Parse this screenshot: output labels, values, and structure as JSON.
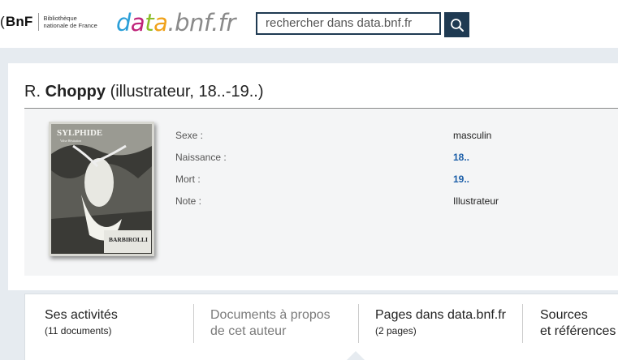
{
  "header": {
    "bnf_logo": {
      "mark": "BnF",
      "line1": "Bibliothèque",
      "line2": "nationale de France"
    },
    "site_logo": {
      "p1": "d",
      "p2": "a",
      "p3": "t",
      "p4": "a",
      "rest": ".bnf.fr"
    },
    "search": {
      "placeholder": "rechercher dans data.bnf.fr"
    }
  },
  "person": {
    "first": "R.",
    "last": "Choppy",
    "qualifier": "(illustrateur, 18..-19..)"
  },
  "details": [
    {
      "label": "Sexe :",
      "value": "masculin"
    },
    {
      "label": "Naissance :",
      "value": "18.."
    },
    {
      "label": "Mort :",
      "value": "19.."
    },
    {
      "label": "Note :",
      "value": "Illustrateur"
    }
  ],
  "poster": {
    "title": "SYLPHIDE",
    "subtitle": "Valse Hésitation",
    "author": "BARBIROLLI"
  },
  "tabs": [
    {
      "line1": "Ses activités",
      "line2": "(11 documents)"
    },
    {
      "line1": "Documents à propos",
      "line2": "de cet auteur"
    },
    {
      "line1": "Pages dans data.bnf.fr",
      "line2": "(2 pages)"
    },
    {
      "line1": "Sources",
      "line2": "et références"
    }
  ],
  "colors": {
    "brand_dark": "#1f3a52",
    "link": "#1b5ea8"
  }
}
